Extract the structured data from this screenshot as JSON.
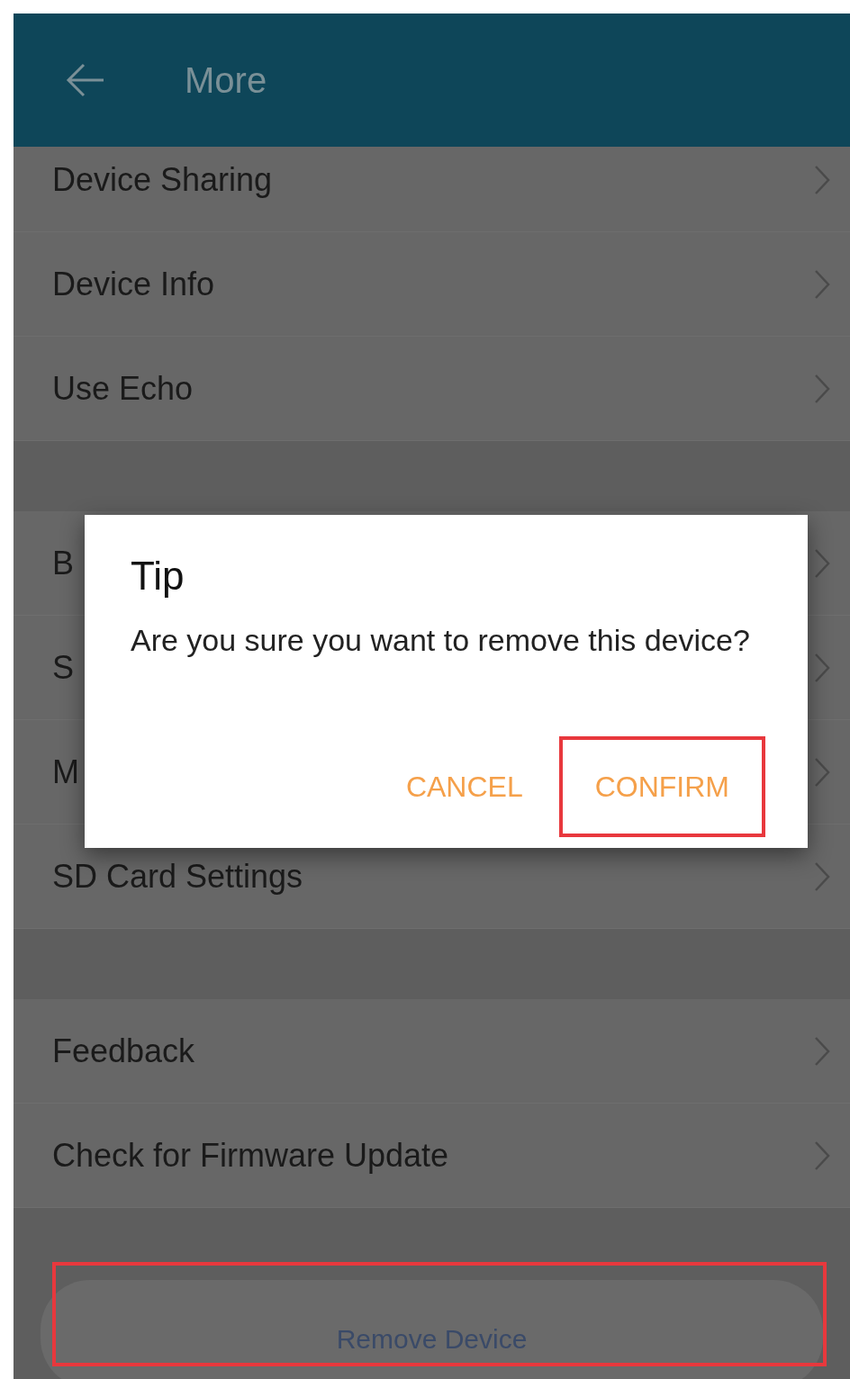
{
  "header": {
    "title": "More"
  },
  "groups": [
    {
      "items": [
        {
          "label": "Device Sharing"
        },
        {
          "label": "Device Info"
        },
        {
          "label": "Use Echo"
        }
      ]
    },
    {
      "items": [
        {
          "label": "B"
        },
        {
          "label": "S"
        },
        {
          "label": "M"
        },
        {
          "label": "SD Card Settings"
        }
      ]
    },
    {
      "items": [
        {
          "label": "Feedback"
        },
        {
          "label": "Check for Firmware Update"
        }
      ]
    }
  ],
  "dialog": {
    "title": "Tip",
    "message": "Are you sure you want to remove this device?",
    "buttons": [
      {
        "label": "CANCEL",
        "highlighted": false
      },
      {
        "label": "CONFIRM",
        "highlighted": true
      }
    ]
  },
  "remove_button": {
    "label": "Remove Device",
    "highlighted": true
  }
}
